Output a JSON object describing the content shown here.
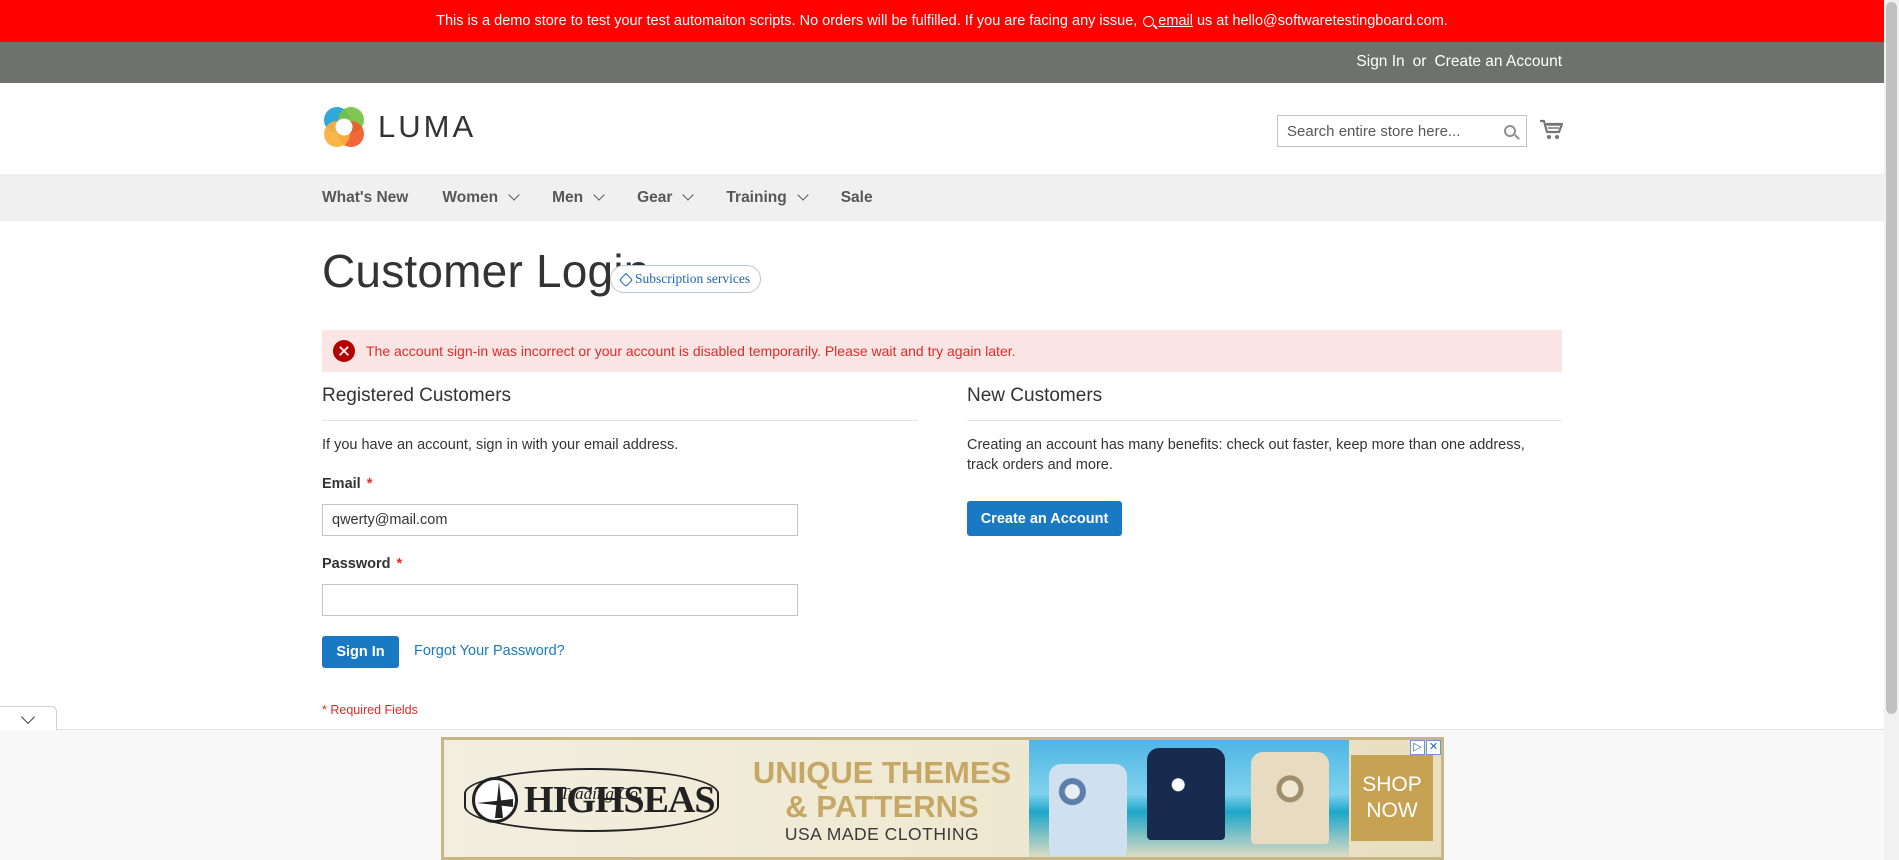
{
  "demo_notice": {
    "text_before": "This is a demo store to test your test automaiton scripts. No orders will be fulfilled. If you are facing any issue,",
    "email_link": "email",
    "text_after": "us at hello@softwaretestingboard.com."
  },
  "header_links": {
    "sign_in": "Sign In",
    "or": "or",
    "create_account": "Create an Account"
  },
  "logo": {
    "text": "LUMA"
  },
  "search": {
    "placeholder": "Search entire store here..."
  },
  "nav": [
    {
      "label": "What's New",
      "dropdown": false
    },
    {
      "label": "Women",
      "dropdown": true
    },
    {
      "label": "Men",
      "dropdown": true
    },
    {
      "label": "Gear",
      "dropdown": true
    },
    {
      "label": "Training",
      "dropdown": true
    },
    {
      "label": "Sale",
      "dropdown": false
    }
  ],
  "page": {
    "title": "Customer Login",
    "subscription_badge": "Subscription services",
    "error_message": "The account sign-in was incorrect or your account is disabled temporarily. Please wait and try again later."
  },
  "registered": {
    "title": "Registered Customers",
    "intro": "If you have an account, sign in with your email address.",
    "email_label": "Email",
    "email_value": "qwerty@mail.com",
    "password_label": "Password",
    "password_value": "",
    "required_mark": "*",
    "sign_in_button": "Sign In",
    "forgot_link": "Forgot Your Password?",
    "required_note": "* Required Fields"
  },
  "new_customers": {
    "title": "New Customers",
    "text_line1": "Creating an account has many benefits: check out faster, keep more than one address,",
    "text_line2": "track orders and more.",
    "button": "Create an Account"
  },
  "ad": {
    "brand": "HIGHSEAS",
    "brand_sub": "Trading Co.",
    "headline_line1": "UNIQUE THEMES",
    "headline_line2": "& PATTERNS",
    "subline": "USA MADE CLOTHING",
    "shop_line1": "SHOP",
    "shop_line2": "NOW",
    "adchoices_icon": "▷",
    "close_icon": "✕"
  },
  "colors": {
    "demo_bar": "#ff0101",
    "panel_header": "#6e716e",
    "primary_button": "#1979c3",
    "error_bg": "#fae5e5",
    "error_text": "#e02b27"
  }
}
